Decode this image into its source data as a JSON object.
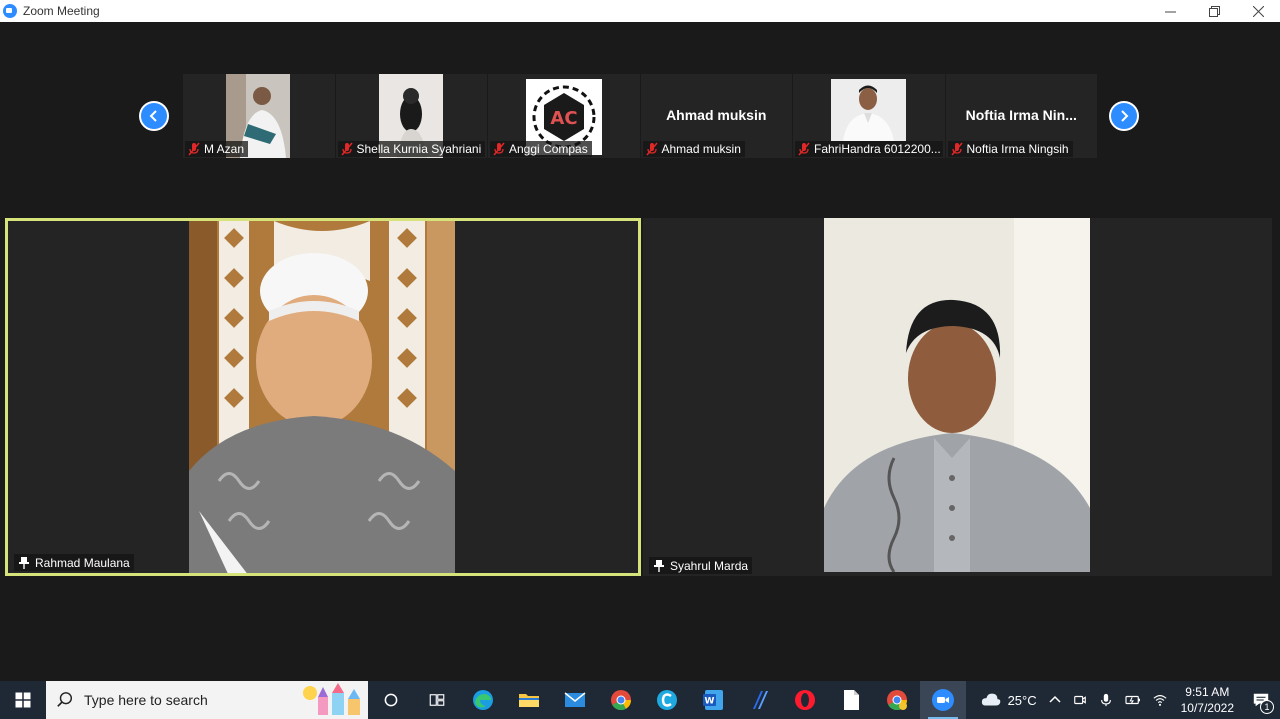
{
  "window": {
    "title": "Zoom Meeting"
  },
  "colors": {
    "active_border": "#d6e37a",
    "zoom_blue": "#2d8cff",
    "mute_red": "#e02828",
    "taskbar": "#1f2936"
  },
  "thumbnails": [
    {
      "name": "M Azan",
      "type": "video",
      "muted": true
    },
    {
      "name": "Shella Kurnia Syahriani",
      "type": "video",
      "muted": true
    },
    {
      "name": "Anggi Compas",
      "type": "avatar",
      "avatar_text": "AC",
      "muted": true
    },
    {
      "name": "Ahmad muksin",
      "display_name": "Ahmad muksin",
      "type": "name",
      "muted": true
    },
    {
      "name": "FahriHandra 6012200...",
      "type": "video",
      "muted": true
    },
    {
      "name": "Noftia Irma Ningsih",
      "display_name": "Noftia Irma Nin...",
      "type": "name",
      "muted": true
    }
  ],
  "main_videos": [
    {
      "name": "Rahmad Maulana",
      "active": true,
      "pinned": true
    },
    {
      "name": "Syahrul Marda",
      "active": false,
      "pinned": true
    }
  ],
  "taskbar": {
    "search_placeholder": "Type here to search",
    "icons": [
      "windows-start-icon",
      "search-icon",
      "task-view-icon",
      "multitasking-icon",
      "edge-icon",
      "file-explorer-icon",
      "mail-icon",
      "chrome-icon",
      "c-app-icon",
      "word-icon",
      "pen-app-icon",
      "opera-icon",
      "file-icon",
      "chrome-profile-icon",
      "zoom-icon"
    ],
    "weather": "25°C",
    "time": "9:51 AM",
    "date": "10/7/2022",
    "notification_count": "1"
  }
}
